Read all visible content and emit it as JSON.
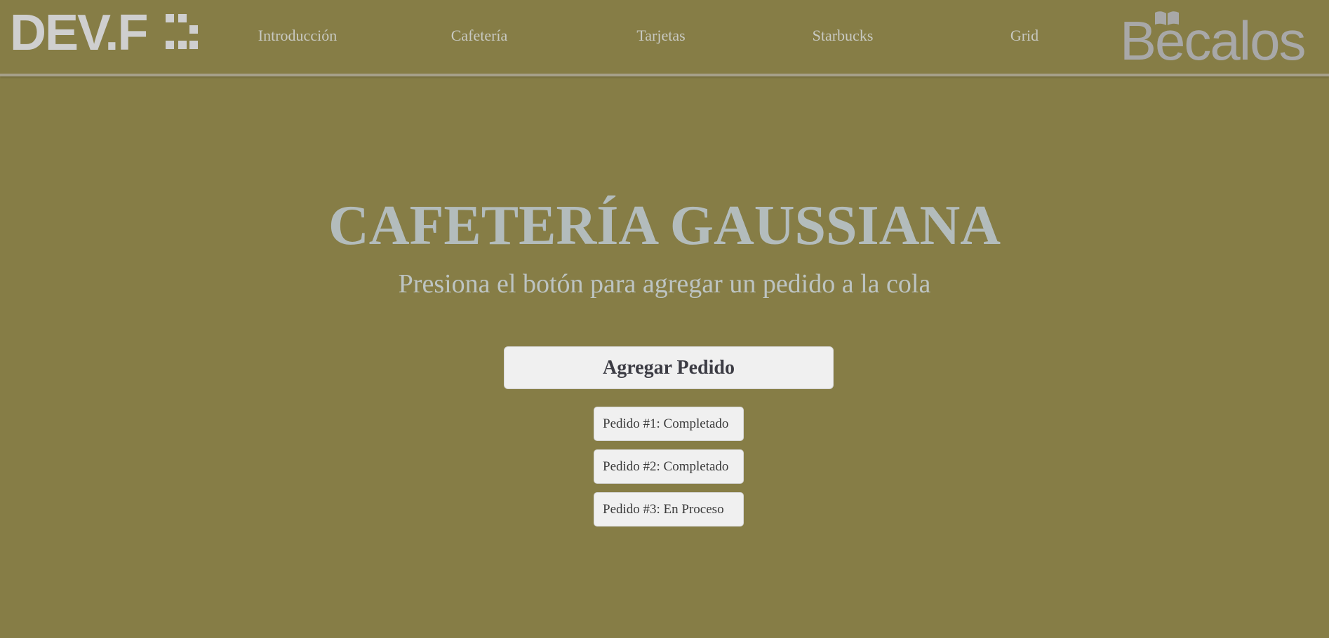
{
  "header": {
    "brand_logo_text": "DEV.F",
    "partner_logo_text": "Becalos",
    "nav_links": [
      {
        "label": "Introducción"
      },
      {
        "label": "Cafetería"
      },
      {
        "label": "Tarjetas"
      },
      {
        "label": "Starbucks"
      },
      {
        "label": "Grid"
      }
    ]
  },
  "main": {
    "title": "CAFETERÍA GAUSSIANA",
    "subtitle": "Presiona el botón para agregar un pedido a la cola",
    "add_button_label": "Agregar Pedido",
    "orders": [
      {
        "text": "Pedido #1: Completado"
      },
      {
        "text": "Pedido #2: Completado"
      },
      {
        "text": "Pedido #3: En Proceso"
      }
    ]
  },
  "colors": {
    "background": "#867d46",
    "nav_text": "#c8c9c2",
    "title_text": "#b3bcbc",
    "card_background": "#f0f0f0"
  }
}
